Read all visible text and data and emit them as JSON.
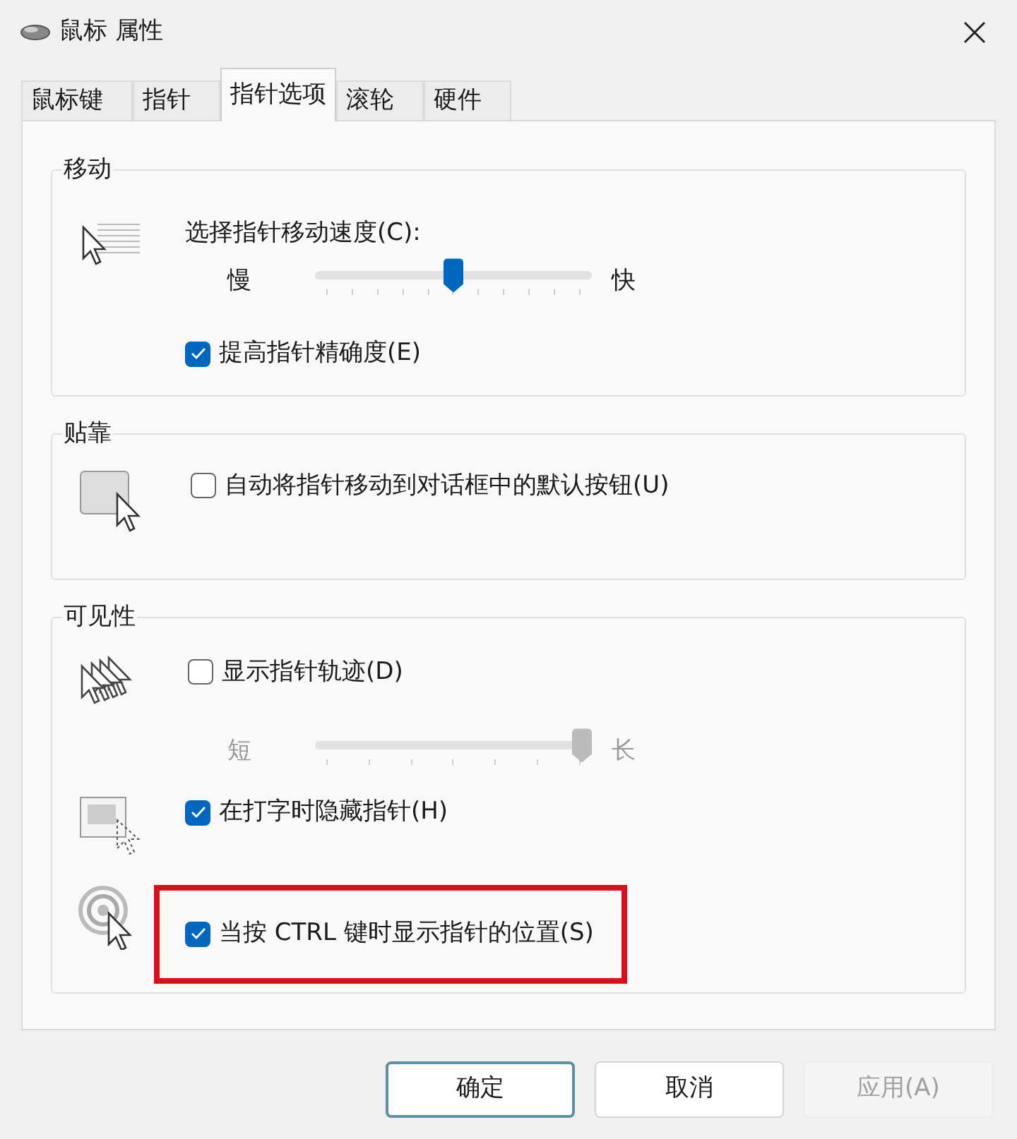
{
  "window": {
    "title": "鼠标 属性"
  },
  "tabs": [
    {
      "label": "鼠标键",
      "selected": false
    },
    {
      "label": "指针",
      "selected": false
    },
    {
      "label": "指针选项",
      "selected": true
    },
    {
      "label": "滚轮",
      "selected": false
    },
    {
      "label": "硬件",
      "selected": false
    }
  ],
  "groups": [
    {
      "title": "移动",
      "rows": [
        {
          "kind": "slider",
          "label": "选择指针移动速度(C):",
          "min_label": "慢",
          "max_label": "快",
          "level": 0.5,
          "disabled": false
        },
        {
          "kind": "checkbox",
          "label": "提高指针精确度(E)",
          "checked": true,
          "highlighted": false
        }
      ]
    },
    {
      "title": "贴靠",
      "rows": [
        {
          "kind": "checkbox",
          "label": "自动将指针移动到对话框中的默认按钮(U)",
          "checked": false,
          "highlighted": false
        }
      ]
    },
    {
      "title": "可见性",
      "rows": [
        {
          "kind": "checkbox",
          "label": "显示指针轨迹(D)",
          "checked": false,
          "highlighted": false
        },
        {
          "kind": "slider",
          "min_label": "短",
          "max_label": "长",
          "level": 1,
          "disabled": true
        },
        {
          "kind": "checkbox",
          "label": "在打字时隐藏指针(H)",
          "checked": true,
          "highlighted": false
        },
        {
          "kind": "checkbox",
          "label": "当按 CTRL 键时显示指针的位置(S)",
          "checked": true,
          "highlighted": true
        }
      ]
    }
  ],
  "buttons": [
    {
      "label": "确定",
      "default": true,
      "disabled": false
    },
    {
      "label": "取消",
      "default": false,
      "disabled": false
    },
    {
      "label": "应用(A)",
      "default": false,
      "disabled": true
    }
  ]
}
